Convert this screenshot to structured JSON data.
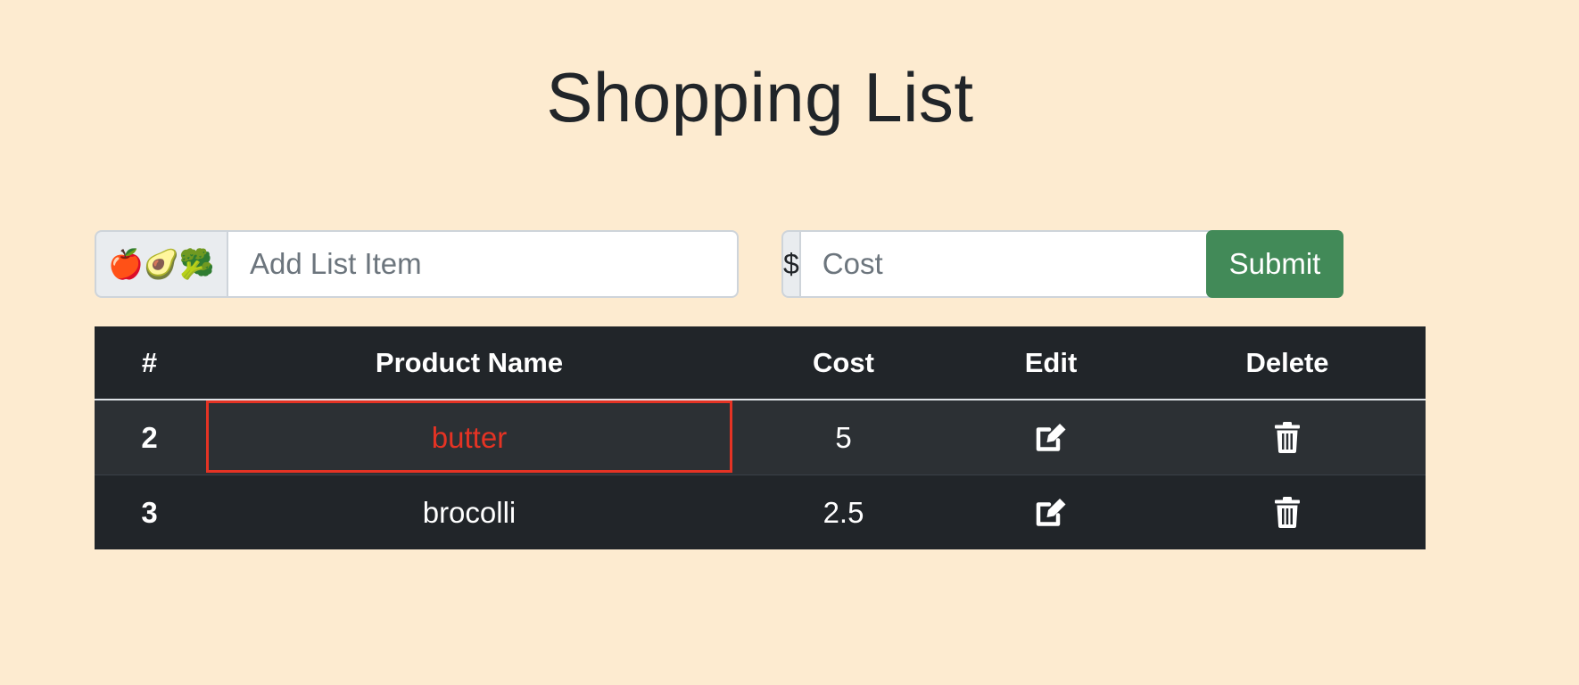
{
  "page": {
    "title": "Shopping List"
  },
  "form": {
    "item_prefix": "🍎🥑🥦",
    "item_placeholder": "Add List Item",
    "item_value": "",
    "cost_prefix": "$",
    "cost_placeholder": "Cost",
    "cost_value": "",
    "submit_label": "Submit"
  },
  "table": {
    "headers": [
      "#",
      "Product Name",
      "Cost",
      "Edit",
      "Delete"
    ],
    "rows": [
      {
        "num": "2",
        "name": "butter",
        "cost": "5",
        "selected": true
      },
      {
        "num": "3",
        "name": "brocolli",
        "cost": "2.5",
        "selected": false
      }
    ],
    "edit_icon": "edit-icon",
    "delete_icon": "trash-icon"
  },
  "colors": {
    "background": "#fdebd0",
    "submit": "#428a58",
    "table_bg": "#212529",
    "selection": "#e53324"
  }
}
